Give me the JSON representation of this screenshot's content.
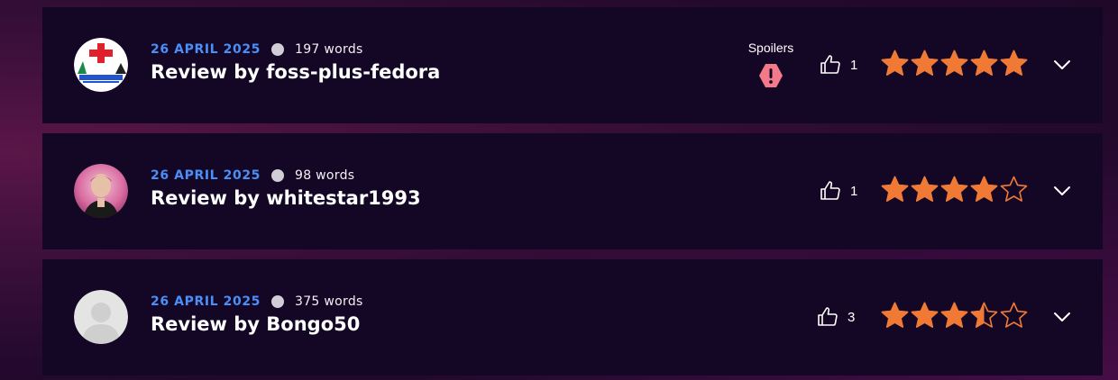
{
  "reviews": [
    {
      "date": "26 APRIL 2025",
      "words": "197 words",
      "title": "Review by foss-plus-fedora",
      "spoilers_label": "Spoilers",
      "has_spoilers": true,
      "likes": "1",
      "rating": 5,
      "avatar": "foss-plus-fedora-logo"
    },
    {
      "date": "26 APRIL 2025",
      "words": "98 words",
      "title": "Review by whitestar1993",
      "has_spoilers": false,
      "likes": "1",
      "rating": 4,
      "avatar": "user-photo"
    },
    {
      "date": "26 APRIL 2025",
      "words": "375 words",
      "title": "Review by Bongo50",
      "has_spoilers": false,
      "likes": "3",
      "rating": 3.5,
      "avatar": "default-avatar"
    }
  ],
  "colors": {
    "accent_date": "#4a8ff7",
    "star": "#f07a35",
    "spoiler": "#f47a8a",
    "card_bg": "#140725"
  }
}
